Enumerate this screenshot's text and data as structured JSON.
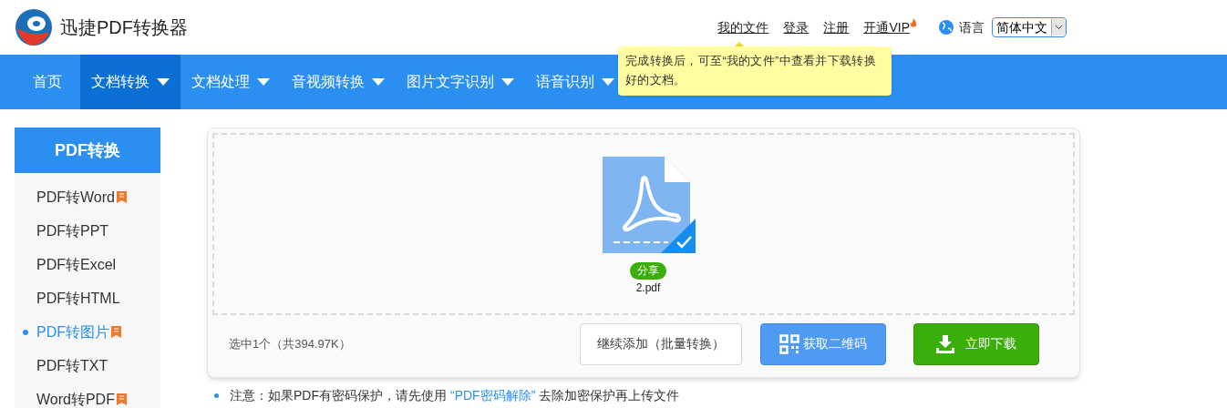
{
  "brand": {
    "name": "迅捷PDF转换器"
  },
  "top_links": [
    {
      "label": "我的文件"
    },
    {
      "label": "登录"
    },
    {
      "label": "注册"
    },
    {
      "label": "开通VIP",
      "hot": true
    }
  ],
  "language": {
    "label": "语言",
    "value": "简体中文"
  },
  "tooltip": {
    "text": "完成转换后，可至“我的文件”中查看并下载转换好的文档。"
  },
  "nav": [
    {
      "label": "首页",
      "dropdown": false,
      "selected": false
    },
    {
      "label": "文档转换",
      "dropdown": true,
      "selected": true
    },
    {
      "label": "文档处理",
      "dropdown": true,
      "selected": false
    },
    {
      "label": "音视频转换",
      "dropdown": true,
      "selected": false
    },
    {
      "label": "图片文字识别",
      "dropdown": true,
      "selected": false
    },
    {
      "label": "语音识别",
      "dropdown": true,
      "selected": false
    }
  ],
  "sidebar": {
    "title": "PDF转换",
    "items": [
      {
        "label": "PDF转Word",
        "recommended": true,
        "selected": false
      },
      {
        "label": "PDF转PPT",
        "recommended": false,
        "selected": false
      },
      {
        "label": "PDF转Excel",
        "recommended": false,
        "selected": false
      },
      {
        "label": "PDF转HTML",
        "recommended": false,
        "selected": false
      },
      {
        "label": "PDF转图片",
        "recommended": true,
        "selected": true
      },
      {
        "label": "PDF转TXT",
        "recommended": false,
        "selected": false
      },
      {
        "label": "Word转PDF",
        "recommended": true,
        "selected": false
      }
    ]
  },
  "files": [
    {
      "name": "2.pdf",
      "badge": "分享",
      "checked": true
    }
  ],
  "summary": "选中1个（共394.97K）",
  "buttons": [
    {
      "kind": "outline",
      "label": "继续添加（批量转换）"
    },
    {
      "kind": "qr",
      "label": "获取二维码"
    },
    {
      "kind": "download",
      "label": "立即下载"
    }
  ],
  "note": {
    "text": "注意：如果PDF有密码保护，请先使用",
    "link": "“PDF密码解除”",
    "after": "去除加密保护再上传文件"
  }
}
